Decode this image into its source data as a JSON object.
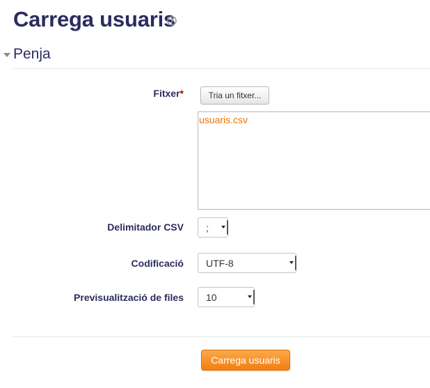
{
  "page": {
    "title": "Carrega usuaris"
  },
  "section": {
    "label": "Penja"
  },
  "form": {
    "file": {
      "label": "Fitxer",
      "required_marker": "*",
      "picker_button": "Tria un fitxer...",
      "files": [
        "usuaris.csv"
      ]
    },
    "delimiter": {
      "label": "Delimitador CSV",
      "value": ";"
    },
    "encoding": {
      "label": "Codificació",
      "value": "UTF-8"
    },
    "preview_rows": {
      "label": "Previsualització de files",
      "value": "10"
    },
    "submit_label": "Carrega usuaris"
  },
  "icons": {
    "help": "help-question-icon",
    "collapse": "triangle-down-icon"
  },
  "colors": {
    "heading": "#2b2b5e",
    "link": "#e8730c",
    "submit": "#f57d0f",
    "required": "#cc0000"
  }
}
